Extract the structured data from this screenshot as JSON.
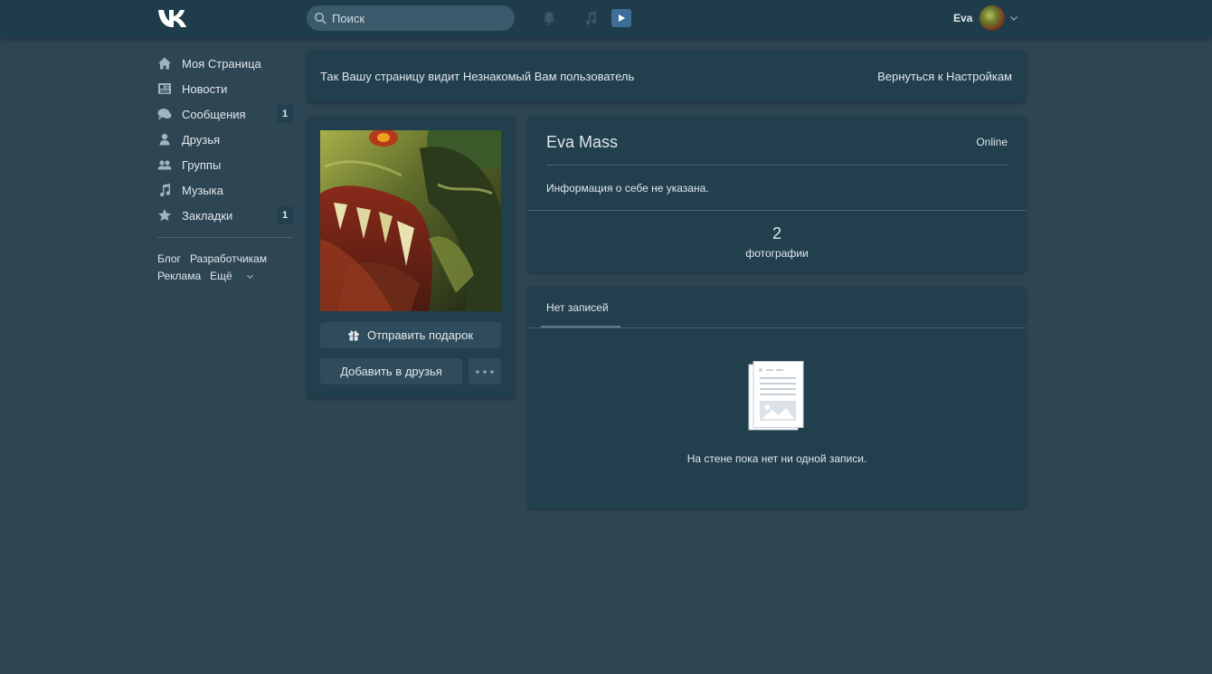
{
  "header": {
    "search_placeholder": "Поиск",
    "user_name": "Eva"
  },
  "sidebar": {
    "items": [
      {
        "label": "Моя Страница",
        "icon": "home-icon",
        "badge": ""
      },
      {
        "label": "Новости",
        "icon": "news-icon",
        "badge": ""
      },
      {
        "label": "Сообщения",
        "icon": "messages-icon",
        "badge": "1"
      },
      {
        "label": "Друзья",
        "icon": "friend-icon",
        "badge": ""
      },
      {
        "label": "Группы",
        "icon": "groups-icon",
        "badge": ""
      },
      {
        "label": "Музыка",
        "icon": "music-note-icon",
        "badge": ""
      },
      {
        "label": "Закладки",
        "icon": "star-icon",
        "badge": "1"
      }
    ],
    "footer_links": [
      "Блог",
      "Разработчикам",
      "Реклама",
      "Ещё"
    ]
  },
  "notice": {
    "text": "Так Вашу страницу видит Незнакомый Вам пользователь",
    "link": "Вернуться к Настройкам"
  },
  "profile": {
    "gift_button": "Отправить подарок",
    "add_friend_button": "Добавить в друзья",
    "name": "Eva Mass",
    "status": "Online",
    "about": "Информация о себе не указана.",
    "photos_count": "2",
    "photos_label": "фотографии"
  },
  "wall": {
    "tab": "Нет записей",
    "empty_text": "На стене пока нет ни одной записи."
  },
  "colors": {
    "background": "#2e4653",
    "header": "#1f3c4a",
    "card": "#213f4d",
    "button": "#2e4c5b",
    "accent_play": "#3d6e9a"
  }
}
